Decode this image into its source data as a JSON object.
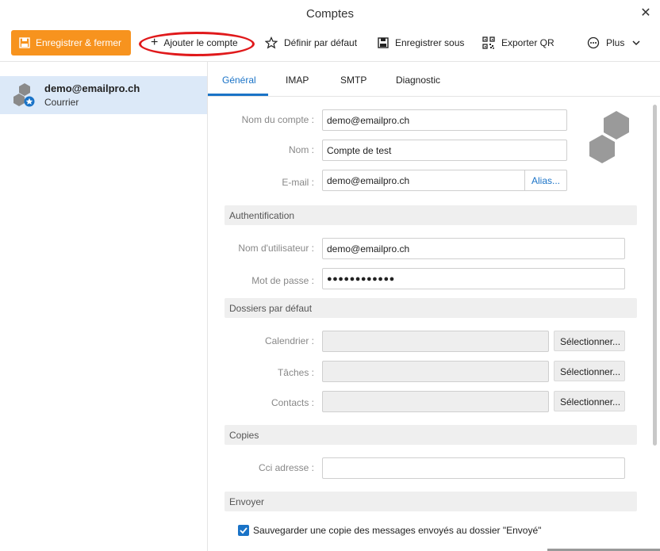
{
  "window": {
    "title": "Comptes",
    "close_icon": "close-icon"
  },
  "toolbar": {
    "save_close": "Enregistrer & fermer",
    "add_account": "Ajouter le compte",
    "set_default": "Définir par défaut",
    "save_as": "Enregistrer sous",
    "export_qr": "Exporter QR",
    "more": "Plus"
  },
  "sidebar": {
    "account": {
      "name": "demo@emailpro.ch",
      "type": "Courrier"
    }
  },
  "tabs": [
    "Général",
    "IMAP",
    "SMTP",
    "Diagnostic"
  ],
  "general": {
    "account_name_label": "Nom du compte :",
    "account_name": "demo@emailpro.ch",
    "name_label": "Nom :",
    "name": "Compte de test",
    "email_label": "E-mail :",
    "email": "demo@emailpro.ch",
    "alias": "Alias..."
  },
  "auth": {
    "section": "Authentification",
    "username_label": "Nom d'utilisateur :",
    "username": "demo@emailpro.ch",
    "password_label": "Mot de passe :",
    "password": "●●●●●●●●●●●●"
  },
  "folders": {
    "section": "Dossiers par défaut",
    "calendar_label": "Calendrier :",
    "tasks_label": "Tâches :",
    "contacts_label": "Contacts :",
    "select": "Sélectionner..."
  },
  "copies": {
    "section": "Copies",
    "bcc_label": "Cci adresse :"
  },
  "send": {
    "section": "Envoyer",
    "save_copy": "Sauvegarder une copie des messages envoyés au dossier \"Envoyé\"",
    "save_copy_checked": true
  },
  "colors": {
    "accent": "#1a73c7",
    "save_button": "#f7931e",
    "highlight": "#e0191b"
  }
}
